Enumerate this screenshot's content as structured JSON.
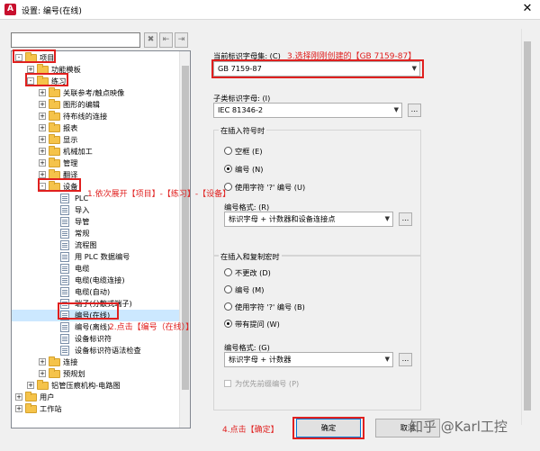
{
  "window": {
    "title": "设置: 编号(在线)",
    "close": "✕"
  },
  "toolbar": {
    "filter_value": "",
    "btn1": "✖",
    "btn2": "⇤",
    "btn3": "⇥"
  },
  "tree": [
    {
      "id": "xiangmu",
      "label": "项目",
      "level": 0,
      "exp": "-",
      "icon": "folder"
    },
    {
      "id": "gongneng",
      "label": "功能模板",
      "level": 1,
      "exp": "+",
      "icon": "folder"
    },
    {
      "id": "lianxi",
      "label": "练习",
      "level": 1,
      "exp": "-",
      "icon": "folder"
    },
    {
      "id": "guanlian",
      "label": "关联参考/触点映像",
      "level": 2,
      "exp": "+",
      "icon": "folder"
    },
    {
      "id": "tuxing",
      "label": "图形的编辑",
      "level": 2,
      "exp": "+",
      "icon": "folder"
    },
    {
      "id": "daibuxian",
      "label": "待布线的连接",
      "level": 2,
      "exp": "+",
      "icon": "folder"
    },
    {
      "id": "baobiao",
      "label": "报表",
      "level": 2,
      "exp": "+",
      "icon": "folder"
    },
    {
      "id": "xianshi",
      "label": "显示",
      "level": 2,
      "exp": "+",
      "icon": "folder"
    },
    {
      "id": "jixie",
      "label": "机械加工",
      "level": 2,
      "exp": "+",
      "icon": "folder"
    },
    {
      "id": "guanli",
      "label": "管理",
      "level": 2,
      "exp": "+",
      "icon": "folder"
    },
    {
      "id": "fanyi",
      "label": "翻译",
      "level": 2,
      "exp": "+",
      "icon": "folder"
    },
    {
      "id": "shebei",
      "label": "设备",
      "level": 2,
      "exp": "-",
      "icon": "folder"
    },
    {
      "id": "plc",
      "label": "PLC",
      "level": 3,
      "exp": "",
      "icon": "page"
    },
    {
      "id": "daoru",
      "label": "导入",
      "level": 3,
      "exp": "",
      "icon": "page"
    },
    {
      "id": "daoguan",
      "label": "导管",
      "level": 3,
      "exp": "",
      "icon": "page"
    },
    {
      "id": "changgui",
      "label": "常规",
      "level": 3,
      "exp": "",
      "icon": "page"
    },
    {
      "id": "liucheng",
      "label": "流程图",
      "level": 3,
      "exp": "",
      "icon": "page"
    },
    {
      "id": "yongplc",
      "label": "用 PLC 数据编号",
      "level": 3,
      "exp": "",
      "icon": "page"
    },
    {
      "id": "dianlan",
      "label": "电缆",
      "level": 3,
      "exp": "",
      "icon": "page"
    },
    {
      "id": "dianlanlj",
      "label": "电缆(电缆连接)",
      "level": 3,
      "exp": "",
      "icon": "page"
    },
    {
      "id": "dianlanzd",
      "label": "电缆(自动)",
      "level": 3,
      "exp": "",
      "icon": "page"
    },
    {
      "id": "duanzi",
      "label": "端子(分散式端子)",
      "level": 3,
      "exp": "",
      "icon": "page"
    },
    {
      "id": "bianhaozx",
      "label": "编号(在线)",
      "level": 3,
      "exp": "",
      "icon": "page",
      "selected": true
    },
    {
      "id": "bianhaolx",
      "label": "编号(离线)",
      "level": 3,
      "exp": "",
      "icon": "page"
    },
    {
      "id": "shebeibs",
      "label": "设备标识符",
      "level": 3,
      "exp": "",
      "icon": "page"
    },
    {
      "id": "shebeibsyf",
      "label": "设备标识符语法检查",
      "level": 3,
      "exp": "",
      "icon": "page"
    },
    {
      "id": "lianjie",
      "label": "连接",
      "level": 2,
      "exp": "+",
      "icon": "folder"
    },
    {
      "id": "yuguihua",
      "label": "预规划",
      "level": 2,
      "exp": "+",
      "icon": "folder"
    },
    {
      "id": "zhaoguan",
      "label": "铝管压痕机构-电路图",
      "level": 1,
      "exp": "+",
      "icon": "folder"
    },
    {
      "id": "yonghu",
      "label": "用户",
      "level": 0,
      "exp": "+",
      "icon": "folder"
    },
    {
      "id": "gongzuozhan",
      "label": "工作站",
      "level": 0,
      "exp": "+",
      "icon": "folder"
    }
  ],
  "annotations": {
    "step1": "1.依次展开【项目】-【练习】-【设备】",
    "step2": "2.点击【编号（在线）】",
    "step3": "3.选择刚刚创建的【GB 7159-87】",
    "step4": "4.点击【确定】"
  },
  "form": {
    "current_set_label": "当前标识字母集: (C)",
    "current_set_value": "GB 7159-87",
    "sub_set_label": "子类标识字母: (I)",
    "sub_set_value": "IEC 81346-2",
    "insert_group": {
      "title": "在插入符号时",
      "options": [
        {
          "label": "空框 (E)",
          "checked": false
        },
        {
          "label": "编号 (N)",
          "checked": true
        },
        {
          "label": "使用字符 '?' 编号 (U)",
          "checked": false
        }
      ],
      "format_label": "编号格式: (R)",
      "format_value": "标识字母 + 计数器和设备连接点"
    },
    "copy_group": {
      "title": "在插入和复制宏时",
      "options": [
        {
          "label": "不更改 (D)",
          "checked": false
        },
        {
          "label": "编号 (M)",
          "checked": false
        },
        {
          "label": "使用字符 '?' 编号 (B)",
          "checked": false
        },
        {
          "label": "带有提问 (W)",
          "checked": true
        }
      ],
      "format_label": "编号格式: (G)",
      "format_value": "标识字母 + 计数器",
      "checkbox_label": "为优先前缀编号 (P)"
    },
    "ok_label": "确定",
    "cancel_label": "取消",
    "dots": "..."
  },
  "watermark": "知乎 @Karl工控"
}
